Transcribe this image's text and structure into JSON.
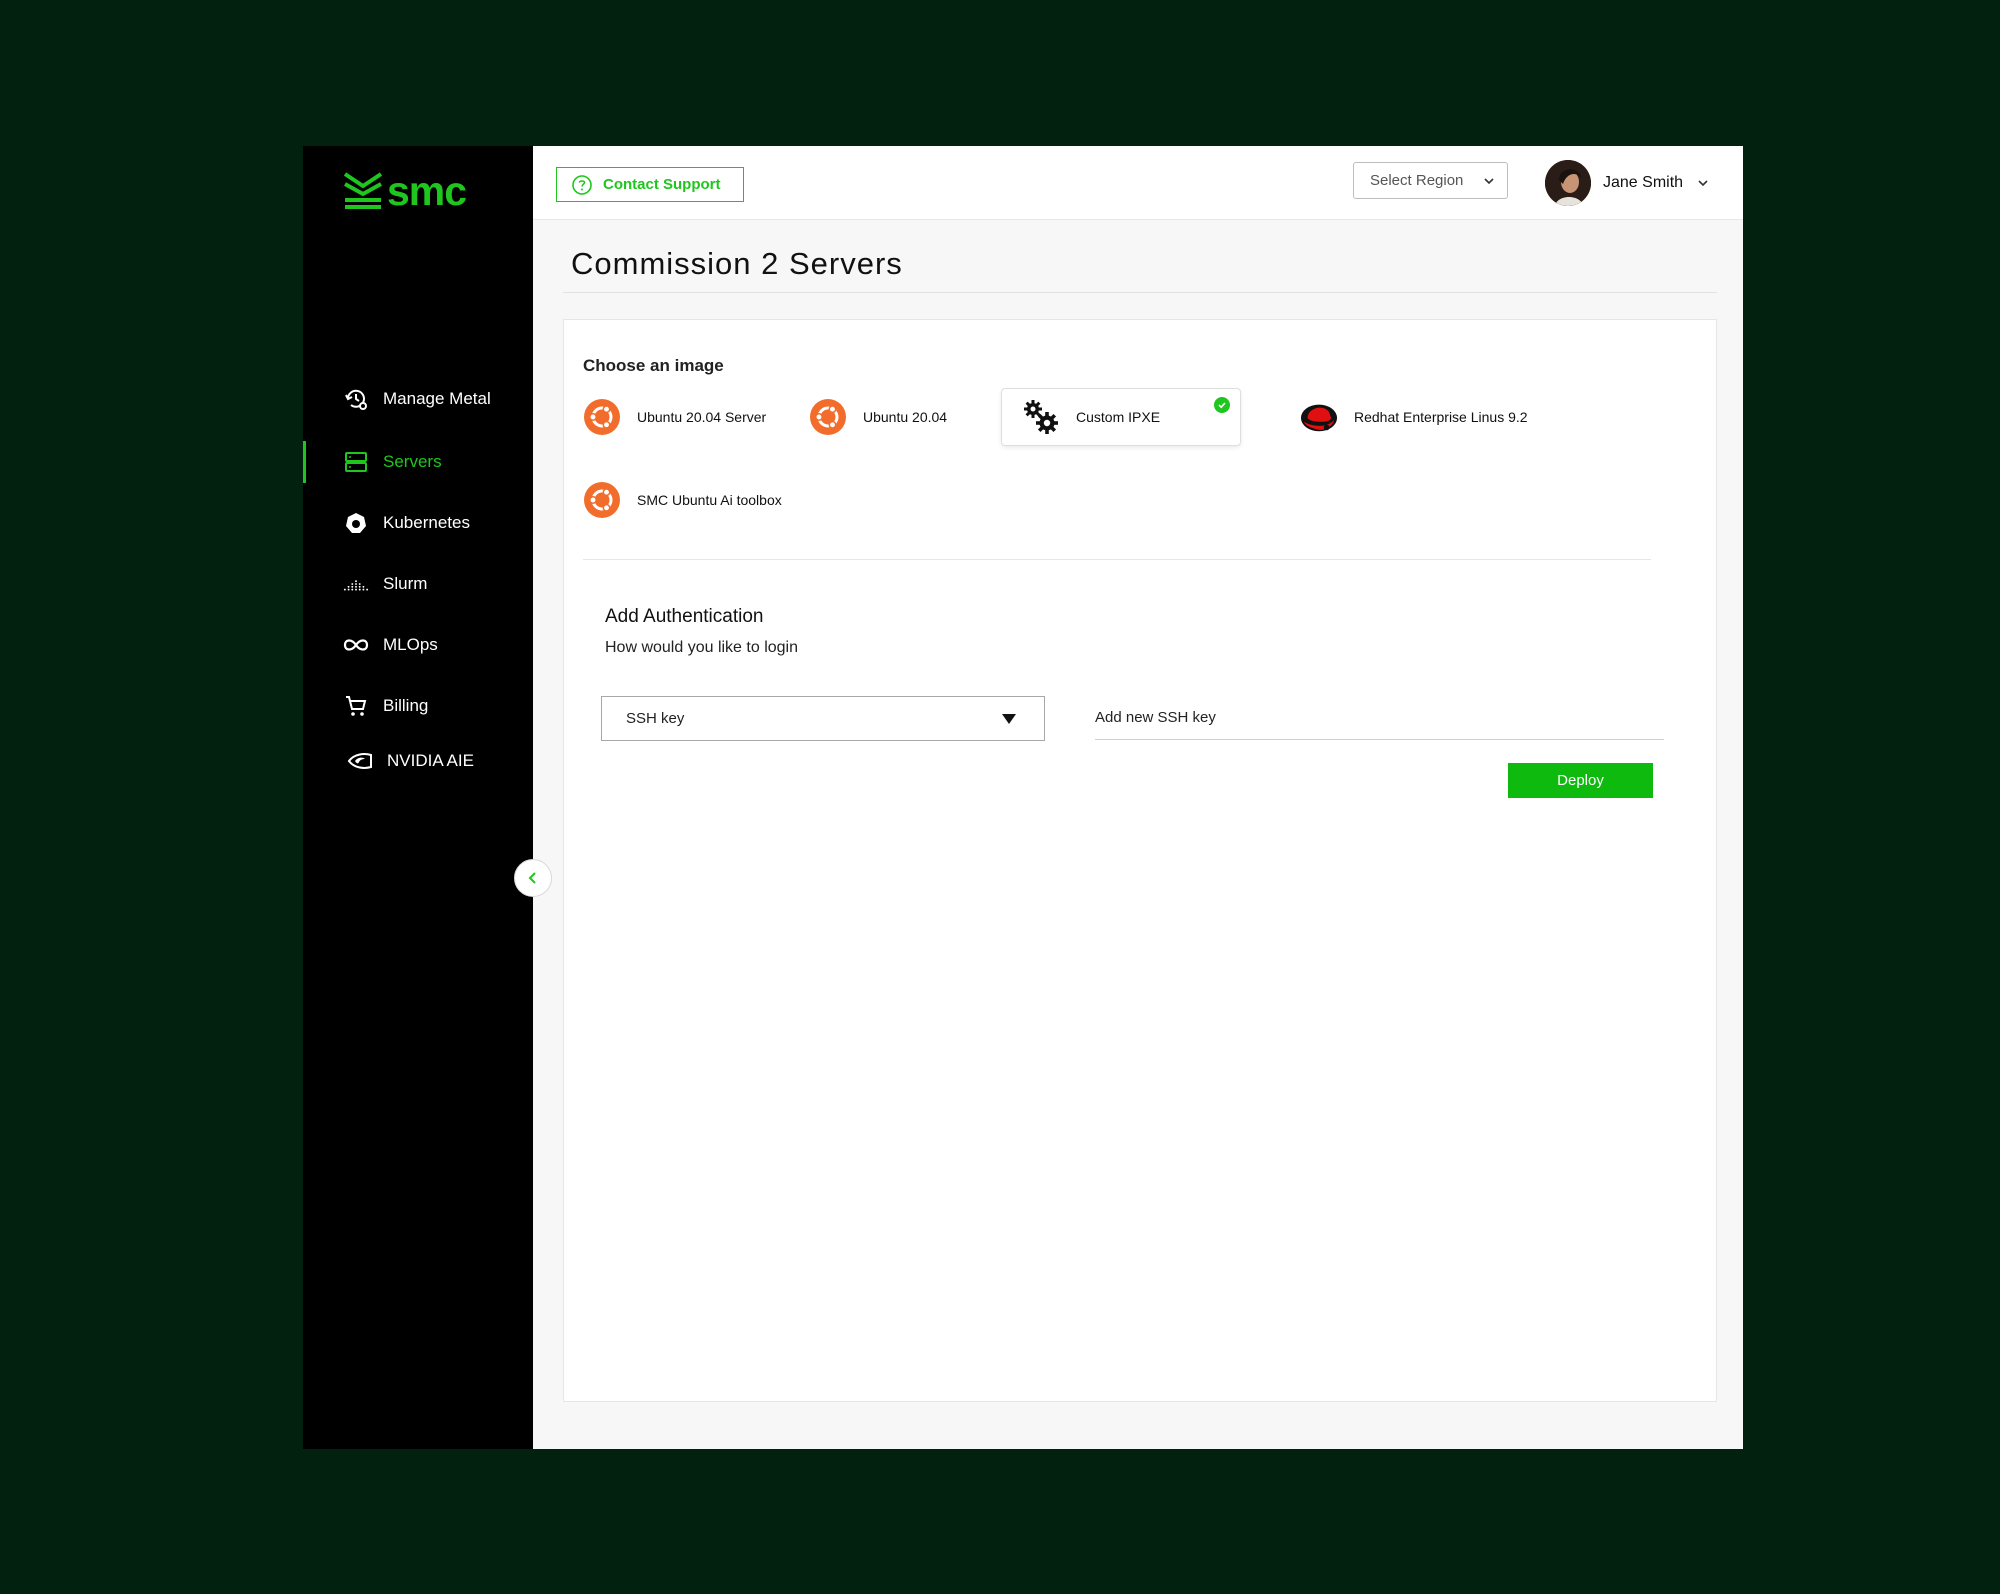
{
  "colors": {
    "accent": "#1ec61e",
    "sidebar_bg": "#000000",
    "page_bg": "#02220f",
    "ubuntu_orange": "#f26d2c",
    "redhat_red": "#e01010"
  },
  "brand": {
    "logo_text": "smc"
  },
  "sidebar": {
    "items": [
      {
        "label": "Manage Metal",
        "icon": "manage-metal-icon",
        "active": false
      },
      {
        "label": "Servers",
        "icon": "servers-icon",
        "active": true
      },
      {
        "label": "Kubernetes",
        "icon": "kubernetes-icon",
        "active": false
      },
      {
        "label": "Slurm",
        "icon": "slurm-icon",
        "active": false
      },
      {
        "label": "MLOps",
        "icon": "infinity-icon",
        "active": false
      },
      {
        "label": "Billing",
        "icon": "cart-icon",
        "active": false
      },
      {
        "label": "NVIDIA AIE",
        "icon": "nvidia-icon",
        "active": false
      }
    ]
  },
  "header": {
    "contact_support": "Contact Support",
    "region_placeholder": "Select Region",
    "user_name": "Jane Smith"
  },
  "main": {
    "title": "Commission 2 Servers",
    "choose_image_label": "Choose an image",
    "images": [
      {
        "label": "Ubuntu 20.04 Server",
        "icon": "ubuntu-icon",
        "selected": false
      },
      {
        "label": "Ubuntu 20.04",
        "icon": "ubuntu-icon",
        "selected": false
      },
      {
        "label": "Custom IPXE",
        "icon": "gears-icon",
        "selected": true
      },
      {
        "label": "Redhat Enterprise Linus 9.2",
        "icon": "redhat-icon",
        "selected": false
      },
      {
        "label": "SMC Ubuntu Ai toolbox",
        "icon": "ubuntu-icon",
        "selected": false
      }
    ],
    "auth": {
      "title": "Add Authentication",
      "subtitle": "How would you like to login",
      "method_value": "SSH key",
      "new_key_label": "Add new SSH key"
    },
    "deploy_label": "Deploy"
  }
}
